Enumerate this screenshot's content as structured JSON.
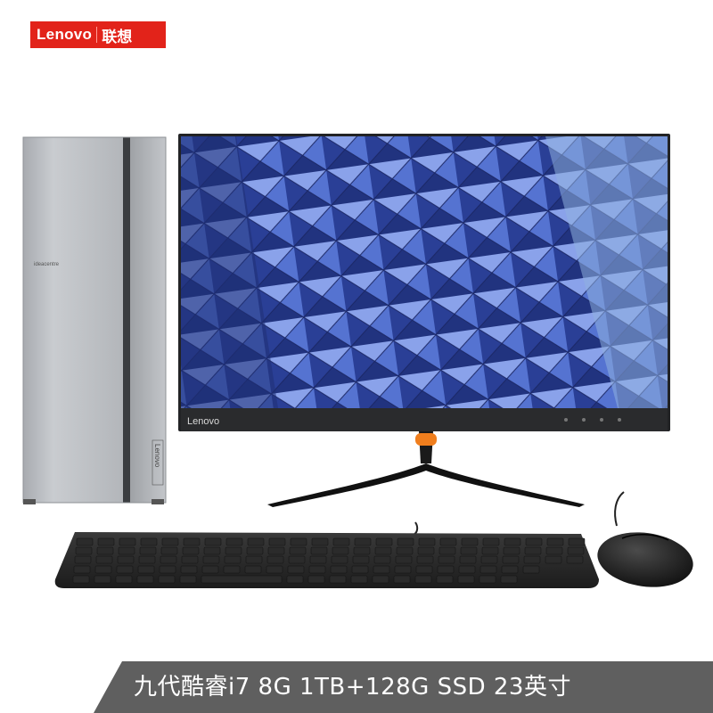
{
  "brand": {
    "name_en": "Lenovo",
    "name_cn": "联想"
  },
  "tower": {
    "label": "ideacentre",
    "side_logo": "Lenovo"
  },
  "monitor": {
    "bezel_logo": "Lenovo"
  },
  "banner": {
    "text": "九代酷睿i7 8G 1TB+128G SSD 23英寸"
  },
  "colors": {
    "brand_red": "#e2231a",
    "banner_gray": "#5f5f5f",
    "stand_accent": "#f07e1d"
  }
}
